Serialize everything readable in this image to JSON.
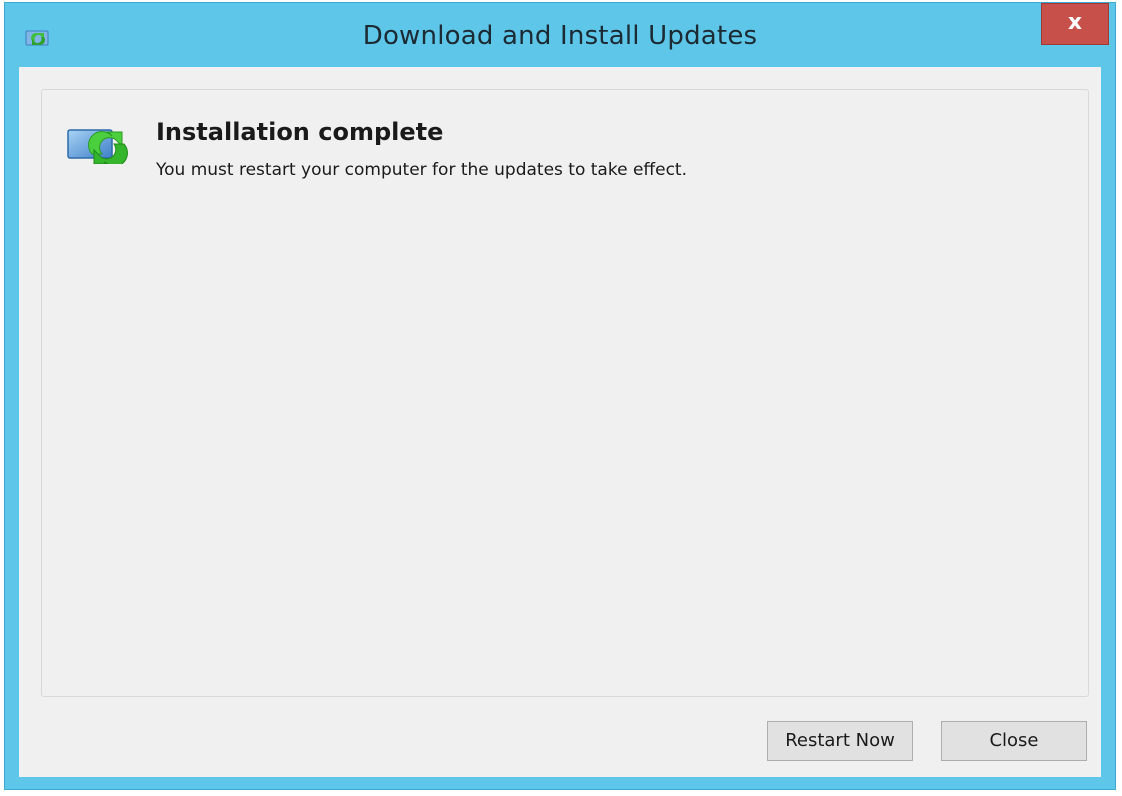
{
  "window": {
    "title": "Download and Install Updates",
    "close_glyph": "x"
  },
  "content": {
    "heading": "Installation complete",
    "message": "You must restart your computer for the updates to take effect."
  },
  "buttons": {
    "restart_label": "Restart Now",
    "close_label": "Close"
  },
  "icons": {
    "title_icon": "windows-update-icon",
    "status_icon": "windows-update-icon",
    "accent_green": "#3fbf3f",
    "accent_blue": "#4a90d9"
  },
  "colors": {
    "title_bar": "#5ec7e9",
    "close_button": "#c7504a",
    "client_background": "#f0f0f0"
  }
}
